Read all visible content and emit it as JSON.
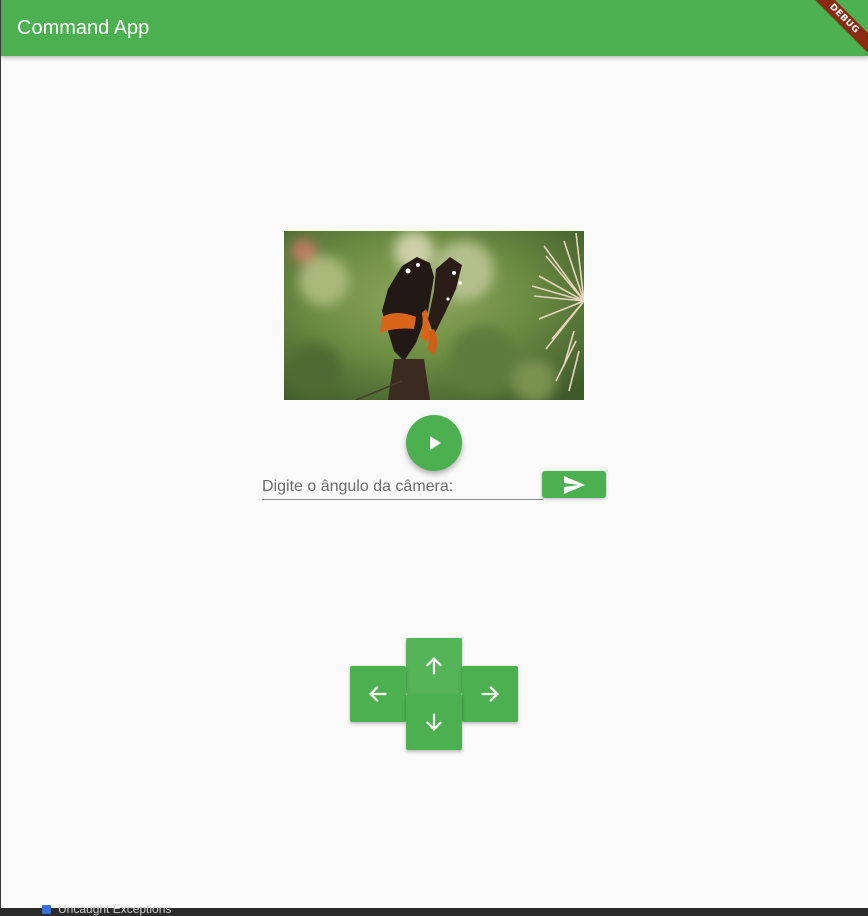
{
  "app": {
    "title": "Command App",
    "debug_banner": "DEBUG"
  },
  "camera": {
    "image_name": "butterfly-photo",
    "play_icon": "play-arrow-icon"
  },
  "angle_input": {
    "placeholder": "Digite o ângulo da câmera:",
    "value": "",
    "send_icon": "send-icon"
  },
  "dpad": {
    "up_icon": "arrow-up-icon",
    "left_icon": "arrow-left-icon",
    "right_icon": "arrow-right-icon",
    "down_icon": "arrow-down-icon"
  },
  "debug_console": {
    "uncaught_label": "Uncaught Exceptions"
  },
  "colors": {
    "primary": "#4caf50",
    "background": "#fafafa",
    "debug_banner": "#8b2b12"
  }
}
